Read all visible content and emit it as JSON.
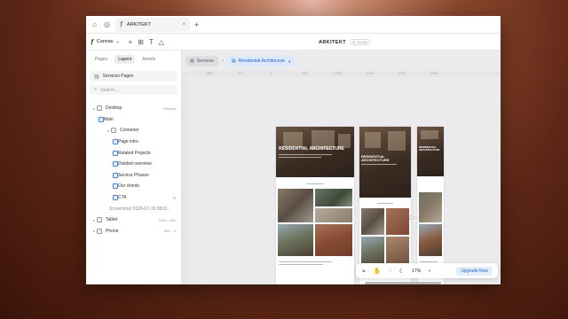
{
  "browser": {
    "tab_title": "ARKITEKT",
    "tab_close": "×",
    "new_tab": "+"
  },
  "toolbar": {
    "canvas_label": "Canvas",
    "project_name": "ARKITEKT",
    "project_badge": "⊘ Invite"
  },
  "panel": {
    "tabs": [
      "Pages",
      "Layers",
      "Assets"
    ],
    "pages_select": "Services Pages",
    "search_placeholder": "Search...",
    "layers": [
      {
        "label": "Desktop",
        "right": "Primary",
        "indent": 0,
        "icon": "dim"
      },
      {
        "label": "Main",
        "right": "",
        "indent": 1,
        "icon": "frame"
      },
      {
        "label": "Container",
        "right": "",
        "indent": 2,
        "icon": "dim"
      },
      {
        "label": "Page intro",
        "right": "",
        "indent": 3,
        "icon": "frame"
      },
      {
        "label": "Related Projects",
        "right": "",
        "indent": 3,
        "icon": "frame"
      },
      {
        "label": "Divided overview",
        "right": "",
        "indent": 3,
        "icon": "frame"
      },
      {
        "label": "Service Phases",
        "right": "",
        "indent": 3,
        "icon": "frame"
      },
      {
        "label": "Our clients",
        "right": "",
        "indent": 3,
        "icon": "frame"
      },
      {
        "label": "CTA",
        "right": "⊡",
        "indent": 3,
        "icon": "frame"
      },
      {
        "label": "Screenshot 2026-07-19 0822...",
        "right": "",
        "indent": 1,
        "icon": "none",
        "muted": true
      },
      {
        "label": "Tablet",
        "right": "1199 – 810",
        "indent": 0,
        "icon": "dim"
      },
      {
        "label": "Phone",
        "right": "809 – 0",
        "indent": 0,
        "icon": "dim"
      }
    ]
  },
  "canvas": {
    "breadcrumbs": [
      "Services",
      "Residential Architecture"
    ],
    "ruler_labels": [
      "-1600",
      "-800",
      "0",
      "800",
      "1600",
      "2400",
      "3200",
      "4000"
    ],
    "frame_titles": {
      "desktop": "RESIDENTIAL ARCHITECTURE",
      "tablet": "RESIDENTIAL ARCHITECTURE",
      "phone": "RESIDENTIAL ARCHITECTURE"
    }
  },
  "bottom_toolbar": {
    "zoom": "17%",
    "upgrade": "Upgrade Now"
  }
}
